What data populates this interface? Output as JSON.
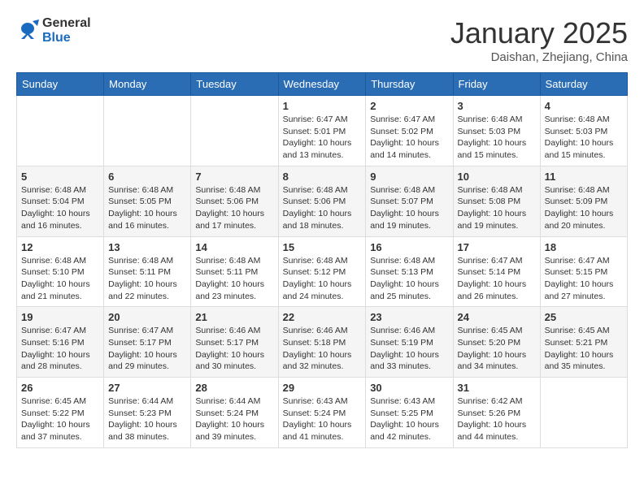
{
  "header": {
    "logo_general": "General",
    "logo_blue": "Blue",
    "title": "January 2025",
    "location": "Daishan, Zhejiang, China"
  },
  "weekdays": [
    "Sunday",
    "Monday",
    "Tuesday",
    "Wednesday",
    "Thursday",
    "Friday",
    "Saturday"
  ],
  "weeks": [
    [
      {
        "day": "",
        "info": ""
      },
      {
        "day": "",
        "info": ""
      },
      {
        "day": "",
        "info": ""
      },
      {
        "day": "1",
        "info": "Sunrise: 6:47 AM\nSunset: 5:01 PM\nDaylight: 10 hours\nand 13 minutes."
      },
      {
        "day": "2",
        "info": "Sunrise: 6:47 AM\nSunset: 5:02 PM\nDaylight: 10 hours\nand 14 minutes."
      },
      {
        "day": "3",
        "info": "Sunrise: 6:48 AM\nSunset: 5:03 PM\nDaylight: 10 hours\nand 15 minutes."
      },
      {
        "day": "4",
        "info": "Sunrise: 6:48 AM\nSunset: 5:03 PM\nDaylight: 10 hours\nand 15 minutes."
      }
    ],
    [
      {
        "day": "5",
        "info": "Sunrise: 6:48 AM\nSunset: 5:04 PM\nDaylight: 10 hours\nand 16 minutes."
      },
      {
        "day": "6",
        "info": "Sunrise: 6:48 AM\nSunset: 5:05 PM\nDaylight: 10 hours\nand 16 minutes."
      },
      {
        "day": "7",
        "info": "Sunrise: 6:48 AM\nSunset: 5:06 PM\nDaylight: 10 hours\nand 17 minutes."
      },
      {
        "day": "8",
        "info": "Sunrise: 6:48 AM\nSunset: 5:06 PM\nDaylight: 10 hours\nand 18 minutes."
      },
      {
        "day": "9",
        "info": "Sunrise: 6:48 AM\nSunset: 5:07 PM\nDaylight: 10 hours\nand 19 minutes."
      },
      {
        "day": "10",
        "info": "Sunrise: 6:48 AM\nSunset: 5:08 PM\nDaylight: 10 hours\nand 19 minutes."
      },
      {
        "day": "11",
        "info": "Sunrise: 6:48 AM\nSunset: 5:09 PM\nDaylight: 10 hours\nand 20 minutes."
      }
    ],
    [
      {
        "day": "12",
        "info": "Sunrise: 6:48 AM\nSunset: 5:10 PM\nDaylight: 10 hours\nand 21 minutes."
      },
      {
        "day": "13",
        "info": "Sunrise: 6:48 AM\nSunset: 5:11 PM\nDaylight: 10 hours\nand 22 minutes."
      },
      {
        "day": "14",
        "info": "Sunrise: 6:48 AM\nSunset: 5:11 PM\nDaylight: 10 hours\nand 23 minutes."
      },
      {
        "day": "15",
        "info": "Sunrise: 6:48 AM\nSunset: 5:12 PM\nDaylight: 10 hours\nand 24 minutes."
      },
      {
        "day": "16",
        "info": "Sunrise: 6:48 AM\nSunset: 5:13 PM\nDaylight: 10 hours\nand 25 minutes."
      },
      {
        "day": "17",
        "info": "Sunrise: 6:47 AM\nSunset: 5:14 PM\nDaylight: 10 hours\nand 26 minutes."
      },
      {
        "day": "18",
        "info": "Sunrise: 6:47 AM\nSunset: 5:15 PM\nDaylight: 10 hours\nand 27 minutes."
      }
    ],
    [
      {
        "day": "19",
        "info": "Sunrise: 6:47 AM\nSunset: 5:16 PM\nDaylight: 10 hours\nand 28 minutes."
      },
      {
        "day": "20",
        "info": "Sunrise: 6:47 AM\nSunset: 5:17 PM\nDaylight: 10 hours\nand 29 minutes."
      },
      {
        "day": "21",
        "info": "Sunrise: 6:46 AM\nSunset: 5:17 PM\nDaylight: 10 hours\nand 30 minutes."
      },
      {
        "day": "22",
        "info": "Sunrise: 6:46 AM\nSunset: 5:18 PM\nDaylight: 10 hours\nand 32 minutes."
      },
      {
        "day": "23",
        "info": "Sunrise: 6:46 AM\nSunset: 5:19 PM\nDaylight: 10 hours\nand 33 minutes."
      },
      {
        "day": "24",
        "info": "Sunrise: 6:45 AM\nSunset: 5:20 PM\nDaylight: 10 hours\nand 34 minutes."
      },
      {
        "day": "25",
        "info": "Sunrise: 6:45 AM\nSunset: 5:21 PM\nDaylight: 10 hours\nand 35 minutes."
      }
    ],
    [
      {
        "day": "26",
        "info": "Sunrise: 6:45 AM\nSunset: 5:22 PM\nDaylight: 10 hours\nand 37 minutes."
      },
      {
        "day": "27",
        "info": "Sunrise: 6:44 AM\nSunset: 5:23 PM\nDaylight: 10 hours\nand 38 minutes."
      },
      {
        "day": "28",
        "info": "Sunrise: 6:44 AM\nSunset: 5:24 PM\nDaylight: 10 hours\nand 39 minutes."
      },
      {
        "day": "29",
        "info": "Sunrise: 6:43 AM\nSunset: 5:24 PM\nDaylight: 10 hours\nand 41 minutes."
      },
      {
        "day": "30",
        "info": "Sunrise: 6:43 AM\nSunset: 5:25 PM\nDaylight: 10 hours\nand 42 minutes."
      },
      {
        "day": "31",
        "info": "Sunrise: 6:42 AM\nSunset: 5:26 PM\nDaylight: 10 hours\nand 44 minutes."
      },
      {
        "day": "",
        "info": ""
      }
    ]
  ]
}
